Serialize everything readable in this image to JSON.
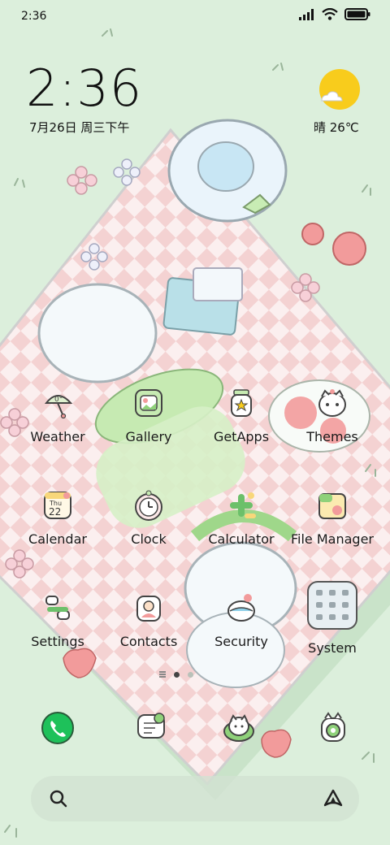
{
  "status_bar": {
    "time": "2:36",
    "icons": [
      "signal-icon",
      "wifi-icon",
      "battery-icon"
    ]
  },
  "clock_widget": {
    "time": "2:36",
    "date": "7月26日 周三下午"
  },
  "weather_widget": {
    "icon": "sun-icon",
    "text": "晴 26℃"
  },
  "apps": [
    {
      "label": "Weather",
      "icon": "weather-icon"
    },
    {
      "label": "Gallery",
      "icon": "gallery-icon"
    },
    {
      "label": "GetApps",
      "icon": "getapps-icon"
    },
    {
      "label": "Themes",
      "icon": "themes-icon"
    },
    {
      "label": "Calendar",
      "icon": "calendar-icon",
      "icon_day": "Thu",
      "icon_date": "22"
    },
    {
      "label": "Clock",
      "icon": "clock-icon"
    },
    {
      "label": "Calculator",
      "icon": "calculator-icon"
    },
    {
      "label": "File Manager",
      "icon": "file-manager-icon"
    },
    {
      "label": "Settings",
      "icon": "settings-icon"
    },
    {
      "label": "Contacts",
      "icon": "contacts-icon"
    },
    {
      "label": "Security",
      "icon": "security-icon"
    },
    {
      "label": "System",
      "icon": "system-folder-icon"
    }
  ],
  "page_indicator": {
    "pages": 2,
    "active": 0
  },
  "dock": [
    {
      "icon": "phone-icon"
    },
    {
      "icon": "messages-icon"
    },
    {
      "icon": "browser-icon"
    },
    {
      "icon": "camera-icon"
    }
  ],
  "search_bar": {
    "icon": "search-icon",
    "assistant_icon": "assistant-icon"
  },
  "colors": {
    "background": "#dcefdc",
    "checker": "#f6d6d6",
    "sun": "#f8cc1c",
    "phone_green": "#1ec15a"
  }
}
